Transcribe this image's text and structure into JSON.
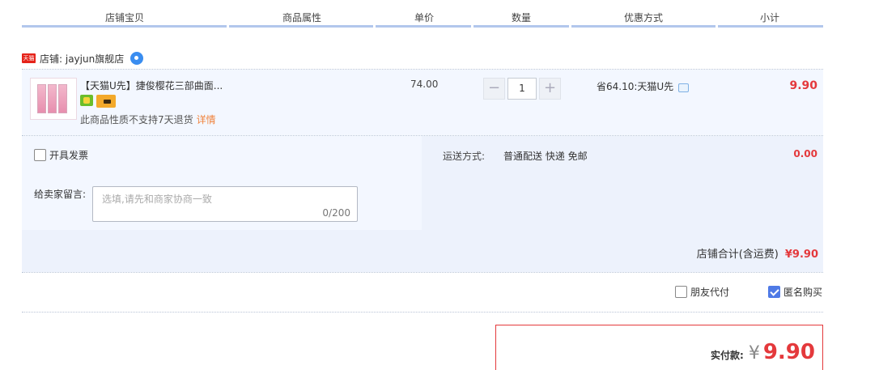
{
  "header": {
    "cols": [
      "店铺宝贝",
      "商品属性",
      "单价",
      "数量",
      "优惠方式",
      "小计"
    ]
  },
  "shop": {
    "badge": "天猫",
    "name": "店铺: jayjun旗舰店"
  },
  "item": {
    "title": "【天猫U先】捷俊樱花三部曲面...",
    "notice": "此商品性质不支持7天退货",
    "notice_link": "详情",
    "unit_price": "74.00",
    "quantity": "1",
    "minus": "−",
    "plus": "+",
    "promotion": "省64.10:天猫U先",
    "subtotal": "9.90"
  },
  "invoice": {
    "label": "开具发票",
    "checked": false
  },
  "message": {
    "label": "给卖家留言:",
    "placeholder": "选填,请先和商家协商一致",
    "counter": "0/200"
  },
  "shipping": {
    "label": "运送方式:",
    "value": "普通配送 快递 免邮",
    "fee": "0.00"
  },
  "shop_total": {
    "label": "店铺合计(含运费)",
    "amount": "¥9.90"
  },
  "options": {
    "friend_pay": "朋友代付",
    "friend_pay_checked": false,
    "anonymous": "匿名购买",
    "anonymous_checked": true
  },
  "payment": {
    "label": "实付款:",
    "currency": "¥",
    "amount": "9.90"
  },
  "colors": {
    "accent_red": "#e4393c",
    "header_line": "#b2c7ec",
    "row_bg": "#f3f7ff"
  }
}
